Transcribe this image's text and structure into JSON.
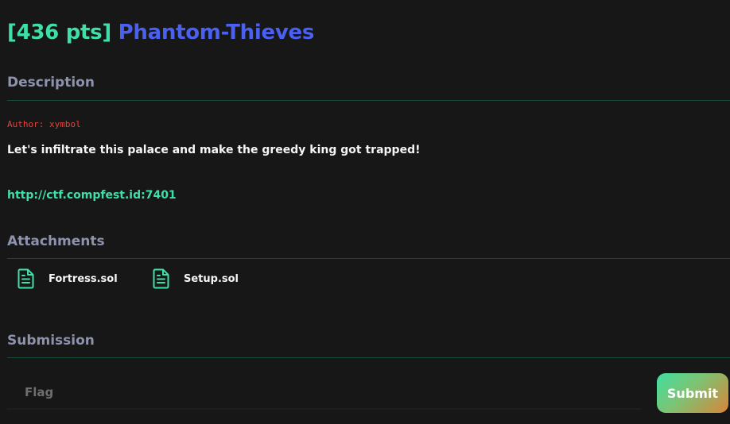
{
  "challenge": {
    "points": "[436 pts]",
    "name": "Phantom-Thieves"
  },
  "sections": {
    "description": "Description",
    "attachments": "Attachments",
    "submission": "Submission"
  },
  "description": {
    "author": "Author: xymbol",
    "text": "Let's infiltrate this palace and make the greedy king got trapped!",
    "link": "http://ctf.compfest.id:7401"
  },
  "attachments": [
    {
      "name": "Fortress.sol",
      "icon": "file-text-icon"
    },
    {
      "name": "Setup.sol",
      "icon": "file-text-icon"
    }
  ],
  "submission": {
    "flag_placeholder": "Flag",
    "flag_value": "",
    "submit_label": "Submit"
  },
  "colors": {
    "background": "#171717",
    "accent_green": "#3fe0a8",
    "accent_blue": "#4a60f0",
    "section_heading": "#8d93ad",
    "author_red": "#e2453f",
    "divider": "#15493a"
  }
}
